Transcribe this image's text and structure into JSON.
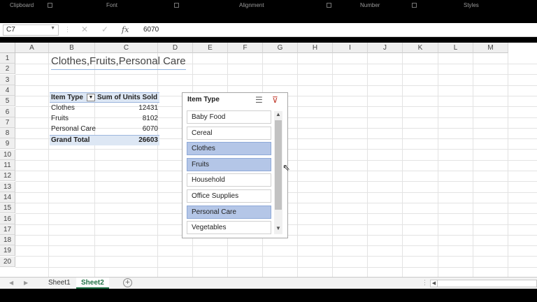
{
  "ribbon": {
    "groups": [
      "Clipboard",
      "Font",
      "Alignment",
      "Number",
      "Styles"
    ]
  },
  "formula_bar": {
    "name_box": "C7",
    "cancel_icon": "cancel-icon",
    "enter_icon": "enter-check-icon",
    "fx_label": "fx",
    "value": "6070"
  },
  "columns": [
    "A",
    "B",
    "C",
    "D",
    "E",
    "F",
    "G",
    "H",
    "I",
    "J",
    "K",
    "L",
    "M"
  ],
  "rows": [
    "1",
    "2",
    "3",
    "4",
    "5",
    "6",
    "7",
    "8",
    "9",
    "10",
    "11",
    "12",
    "13",
    "14",
    "15",
    "16",
    "17",
    "18",
    "19",
    "20"
  ],
  "title_cell": "Clothes,Fruits,Personal Care",
  "pivot": {
    "header_row_label": "Item Type",
    "header_value": "Sum of Units Sold",
    "rows": [
      {
        "label": "Clothes",
        "value": "12431"
      },
      {
        "label": "Fruits",
        "value": "8102"
      },
      {
        "label": "Personal Care",
        "value": "6070"
      }
    ],
    "total_label": "Grand Total",
    "total_value": "26603"
  },
  "slicer": {
    "title": "Item Type",
    "items": [
      {
        "label": "Baby Food",
        "selected": false
      },
      {
        "label": "Cereal",
        "selected": false
      },
      {
        "label": "Clothes",
        "selected": true
      },
      {
        "label": "Fruits",
        "selected": true
      },
      {
        "label": "Household",
        "selected": false
      },
      {
        "label": "Office Supplies",
        "selected": false
      },
      {
        "label": "Personal Care",
        "selected": true
      },
      {
        "label": "Vegetables",
        "selected": false
      }
    ]
  },
  "sheets": {
    "tabs": [
      "Sheet1",
      "Sheet2"
    ],
    "active": "Sheet2"
  },
  "colors": {
    "selected_item": "#b4c6e7",
    "pivot_header": "#dde7f4",
    "active_tab": "#217346"
  }
}
